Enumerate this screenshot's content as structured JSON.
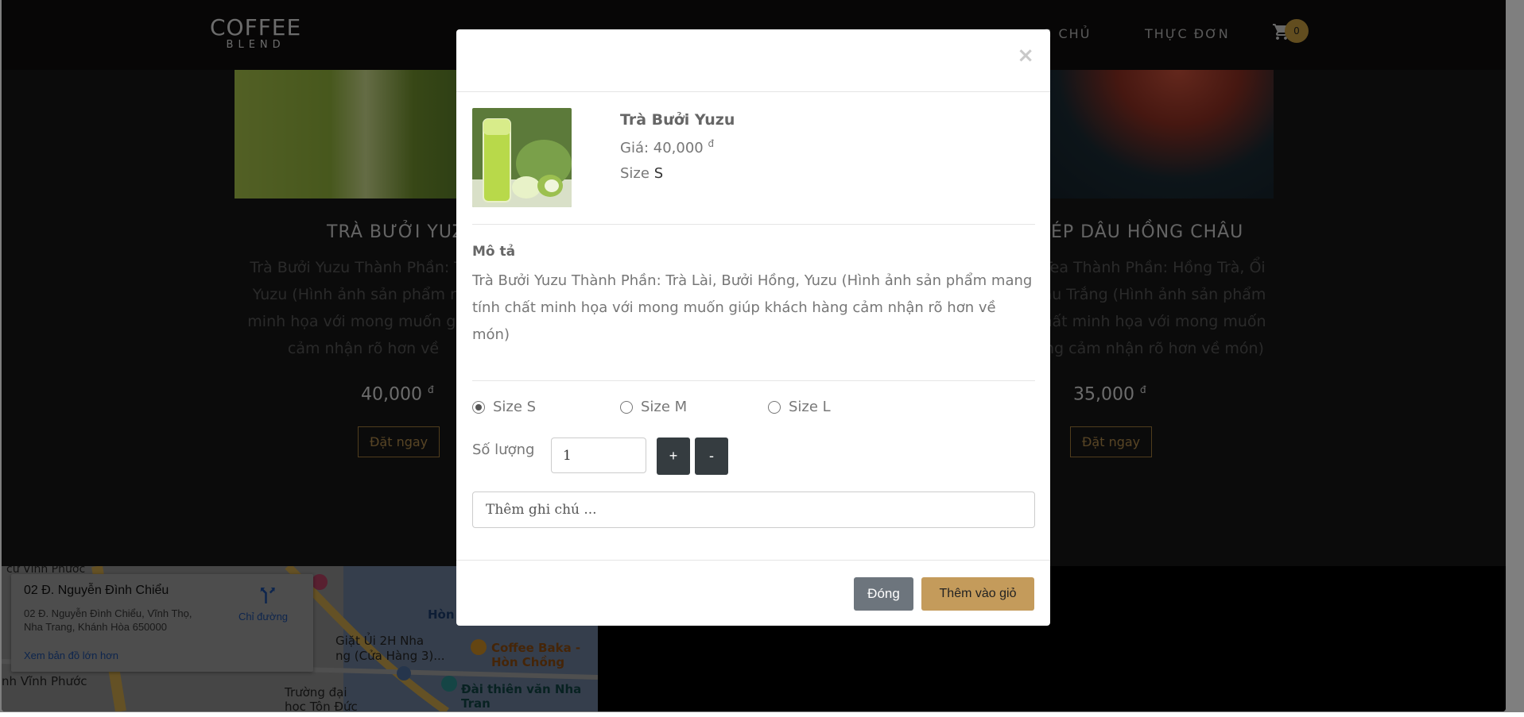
{
  "nav": {
    "logo_line1": "COFFEE",
    "logo_line2": "BLEND",
    "home_partial": "G CHỦ",
    "menu": "THỰC ĐƠN",
    "cart_count": "0"
  },
  "background_cards": [
    {
      "title": "TRÀ BƯỞI YUZ",
      "desc": "Trà Bưởi Yuzu Thành Phần: Trà\nYuzu (Hình ảnh sản phẩm mo\nminh họa với mong muốn giúp\ncảm nhận rõ hơn về",
      "price": "40,000",
      "currency": "đ",
      "button": "Đặt ngay"
    },
    {
      "title": "ÉP DÂU HỒNG CHÂU",
      "desc": "Tea Thành Phần: Hồng Trà, Ổi\nâu Trắng (Hình ảnh sản phẩm\nhất minh họa với mong muốn\nng cảm nhận rõ hơn về món)",
      "price": "35,000",
      "currency": "đ",
      "button": "Đặt ngay"
    }
  ],
  "map": {
    "place_name": "02 Đ. Nguyễn Đình Chiểu",
    "address_line1": "02 Đ. Nguyễn Đình Chiểu, Vĩnh Thọ,",
    "address_line2": "Nha Trang, Khánh Hòa 650000",
    "directions": "Chỉ đường",
    "larger_map": "Xem bản đồ lớn hơn",
    "labels": [
      "cư Vĩnh Phước",
      "Giặt Ủi 2H Nha",
      "ng (Cửa Hàng 3)...",
      "Coffee Baka -",
      "Hòn Chồng",
      "Trường đại",
      "học Tôn Đức",
      "Đài thiên văn Nha Tran",
      "nh Vĩnh Phước",
      "Hòn"
    ]
  },
  "modal": {
    "close_symbol": "×",
    "product_name": "Trà Bưởi Yuzu",
    "price_label": "Giá: 40,000",
    "price_currency": "đ",
    "size_label": "Size",
    "size_value": "S",
    "description_title": "Mô tả",
    "description": "Trà Bưởi Yuzu Thành Phần: Trà Lài, Bưởi Hồng, Yuzu (Hình ảnh sản phẩm mang tính chất minh họa với mong muốn giúp khách hàng cảm nhận rõ hơn về món)",
    "size_options": [
      {
        "label": "Size S",
        "selected": true
      },
      {
        "label": "Size M",
        "selected": false
      },
      {
        "label": "Size L",
        "selected": false
      }
    ],
    "quantity_label": "Số lượng",
    "quantity_value": "1",
    "plus": "+",
    "minus": "-",
    "note_placeholder": "Thêm ghi chú ...",
    "close_button": "Đóng",
    "add_button": "Thêm vào giỏ"
  },
  "colors": {
    "accent": "#c49b5b",
    "dark_button": "#353c40",
    "gray_button": "#6d757d"
  }
}
